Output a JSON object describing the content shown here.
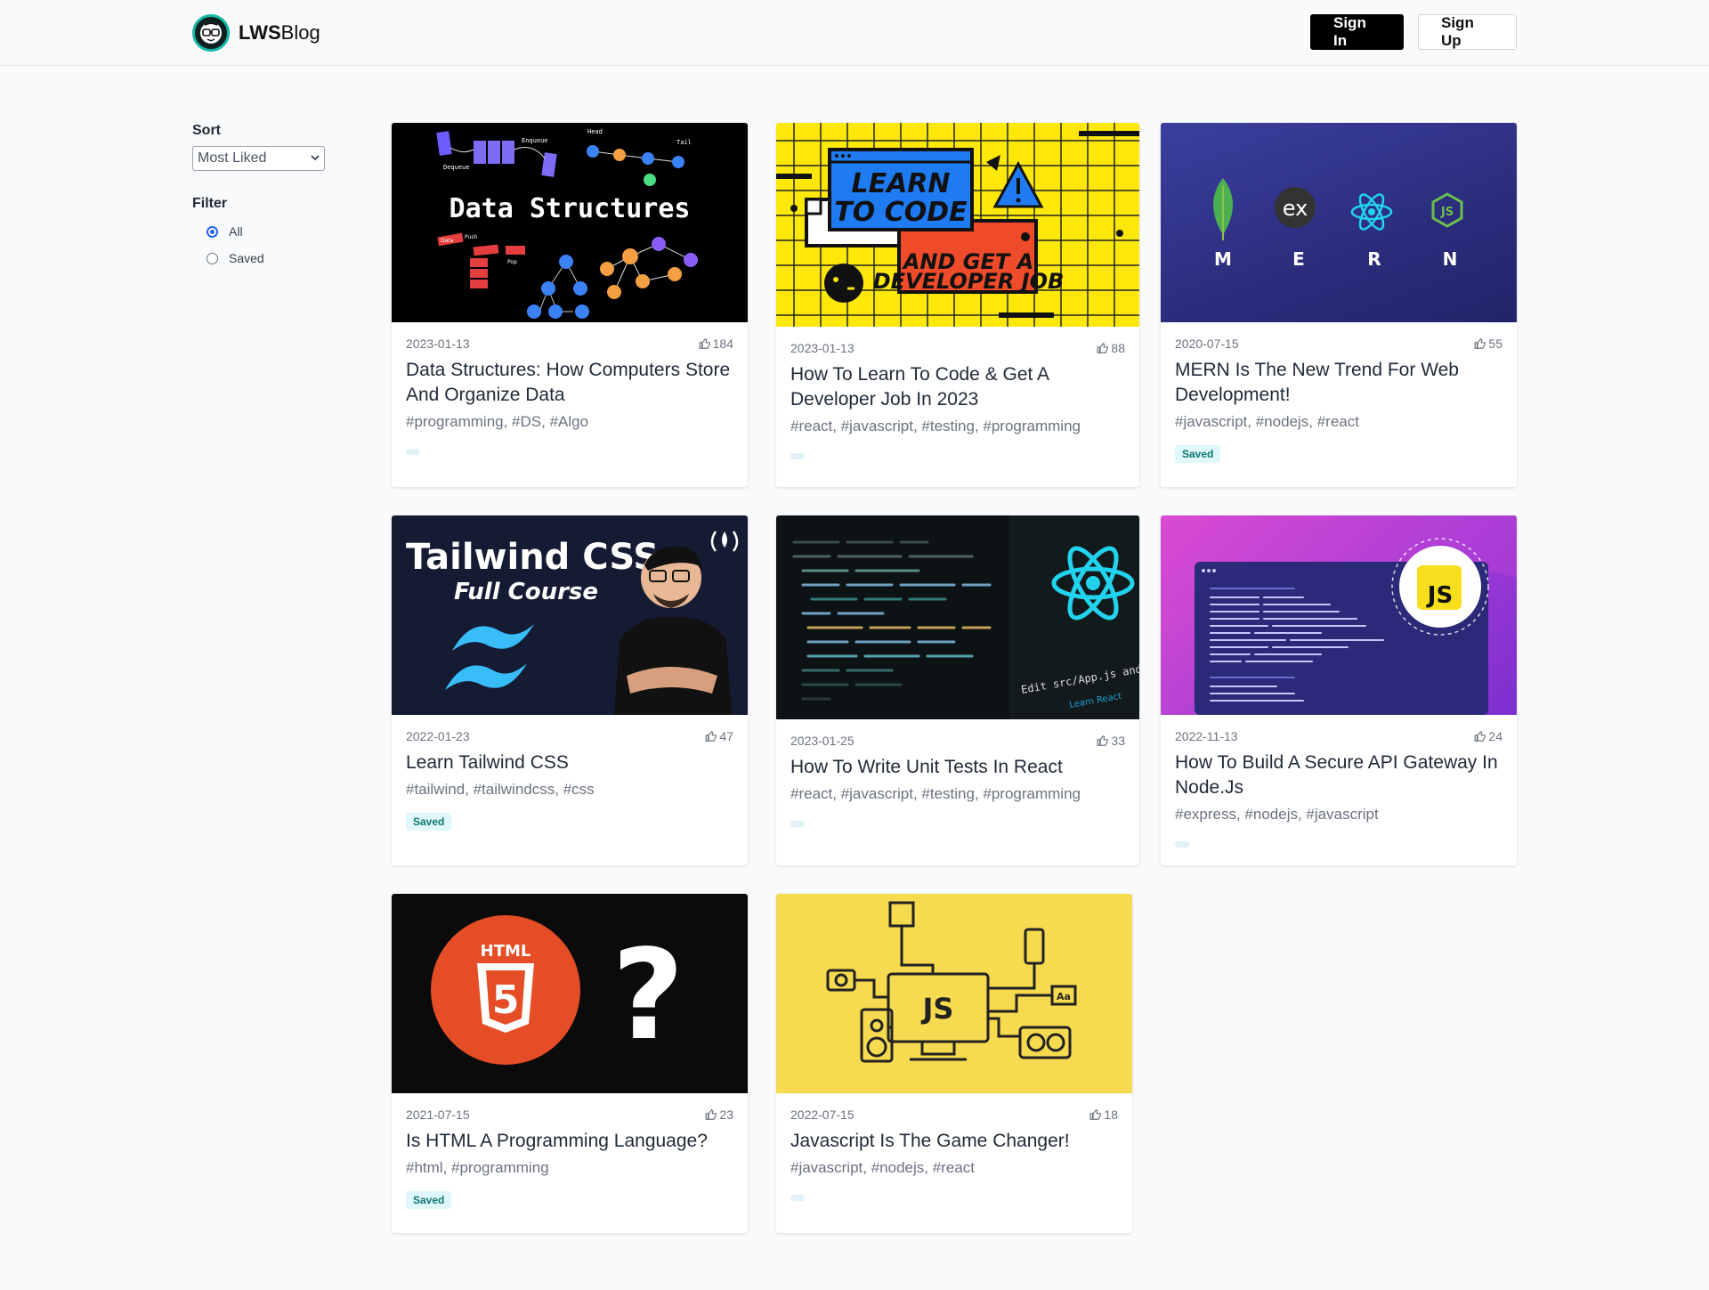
{
  "header": {
    "brand_bold": "LWS",
    "brand_rest": "Blog",
    "sign_in": "Sign In",
    "sign_up": "Sign Up"
  },
  "sidebar": {
    "sort_label": "Sort",
    "sort_value": "Most Liked",
    "filter_label": "Filter",
    "filter_all": "All",
    "filter_saved": "Saved"
  },
  "posts": [
    {
      "date": "2023-01-13",
      "likes": "184",
      "title": "Data Structures: How Computers Store And Organize Data",
      "tags": "#programming, #DS, #Algo",
      "saved": ""
    },
    {
      "date": "2023-01-13",
      "likes": "88",
      "title": "How To Learn To Code & Get A Developer Job In 2023",
      "tags": "#react, #javascript, #testing, #programming",
      "saved": ""
    },
    {
      "date": "2020-07-15",
      "likes": "55",
      "title": "MERN Is The New Trend For Web Development!",
      "tags": "#javascript, #nodejs, #react",
      "saved": "Saved"
    },
    {
      "date": "2022-01-23",
      "likes": "47",
      "title": "Learn Tailwind CSS",
      "tags": "#tailwind, #tailwindcss, #css",
      "saved": "Saved"
    },
    {
      "date": "2023-01-25",
      "likes": "33",
      "title": "How To Write Unit Tests In React",
      "tags": "#react, #javascript, #testing, #programming",
      "saved": ""
    },
    {
      "date": "2022-11-13",
      "likes": "24",
      "title": "How To Build A Secure API Gateway In Node.Js",
      "tags": "#express, #nodejs, #javascript",
      "saved": ""
    },
    {
      "date": "2021-07-15",
      "likes": "23",
      "title": "Is HTML A Programming Language?",
      "tags": "#html, #programming",
      "saved": "Saved"
    },
    {
      "date": "2022-07-15",
      "likes": "18",
      "title": "Javascript Is The Game Changer!",
      "tags": "#javascript, #nodejs, #react",
      "saved": ""
    }
  ],
  "thumb_text": {
    "ds_title": "Data Structures",
    "ds_enqueue": "Enqueue",
    "ds_dequeue": "Dequeue",
    "ds_head": "Head",
    "ds_tail": "Tail",
    "ds_push": "Push",
    "ds_pop": "Pop",
    "ds_data": "Data",
    "ltc_line1": "LEARN",
    "ltc_line2": "TO CODE",
    "ltc_line3": "AND GET A",
    "ltc_line4": "DEVELOPER JOB",
    "mern_m": "M",
    "mern_e": "E",
    "mern_r": "R",
    "mern_n": "N",
    "mern_ex": "ex",
    "mern_js": "JS",
    "tw_title": "Tailwind CSS",
    "tw_sub": "Full Course",
    "react_edit": "Edit src/App.js and save to reload.",
    "react_learn": "Learn React",
    "api_js": "JS",
    "html_label": "HTML",
    "html_five": "5",
    "html_q": "?",
    "jsgc_js": "JS",
    "jsgc_aa": "Aa"
  },
  "colors": {
    "accent": "#14b8a6",
    "badge_bg": "#e0f7fb",
    "badge_text": "#0f766e",
    "radio": "#2563eb"
  }
}
